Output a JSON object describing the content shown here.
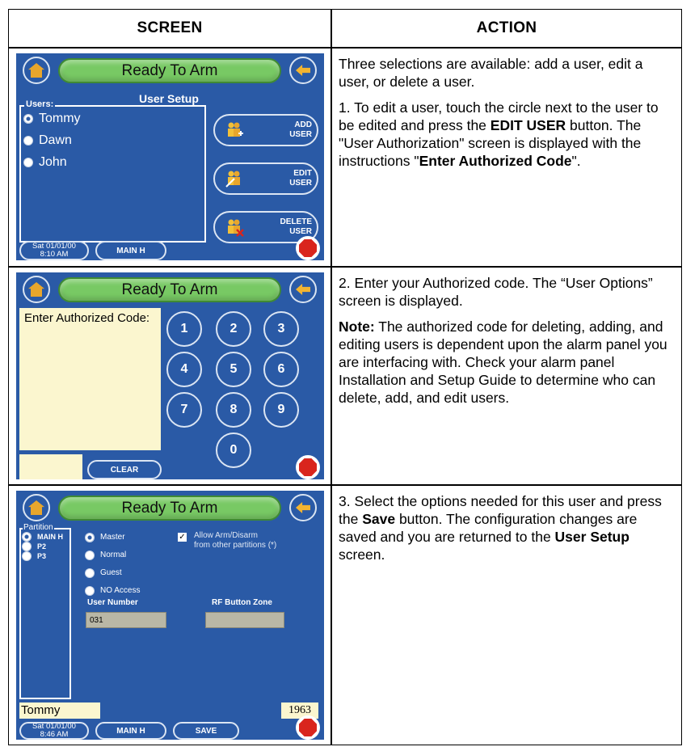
{
  "table": {
    "header_screen": "SCREEN",
    "header_action": "ACTION"
  },
  "row1": {
    "screen": {
      "title": "Ready To Arm",
      "section_title": "User Setup",
      "users_label": "Users:",
      "users": [
        "Tommy",
        "Dawn",
        "John"
      ],
      "selected_user": "Tommy",
      "buttons": {
        "add": [
          "ADD",
          "USER"
        ],
        "edit": [
          "EDIT",
          "USER"
        ],
        "delete": [
          "DELETE",
          "USER"
        ]
      },
      "date": "Sat 01/01/00",
      "time": "8:10 AM",
      "partition_button": "MAIN H"
    },
    "action": {
      "p1": "Three selections are available: add a user, edit a user, or delete a user.",
      "p2_a": "1. To edit a user, touch the circle next to the user to be edited and press the ",
      "p2_b": "EDIT USER",
      "p2_c": " button.  The \"User Authorization\" screen is displayed with the instructions \"",
      "p2_d": "Enter Authorized Code",
      "p2_e": "\"."
    }
  },
  "row2": {
    "screen": {
      "title": "Ready To Arm",
      "prompt": "Enter Authorized Code:",
      "keys": [
        "1",
        "2",
        "3",
        "4",
        "5",
        "6",
        "7",
        "8",
        "9",
        "0"
      ],
      "clear": "CLEAR"
    },
    "action": {
      "p1": "2. Enter your Authorized code.  The “User Options” screen is displayed.",
      "note_label": "Note:",
      "note_text": " The authorized code for deleting, adding, and editing users is dependent upon the alarm panel you are interfacing with. Check your alarm panel Installation and Setup Guide to determine who can delete, add, and edit users."
    }
  },
  "row3": {
    "screen": {
      "title": "Ready To Arm",
      "partition_label": "Partition",
      "partitions": [
        "MAIN H",
        "P2",
        "P3"
      ],
      "access_levels": [
        "Master",
        "Normal",
        "Guest",
        "NO Access"
      ],
      "allow_label_1": "Allow Arm/Disarm",
      "allow_label_2": "from other partitions (*)",
      "user_number_label": "User Number",
      "rf_zone_label": "RF Button Zone",
      "user_number": "031",
      "rf_zone": "",
      "name": "Tommy",
      "code": "1963",
      "date": "Sat 01/01/00",
      "time": "8:46 AM",
      "partition_button": "MAIN H",
      "save": "SAVE"
    },
    "action": {
      "p1_a": "3.  Select the options needed for this user and press the ",
      "p1_b": "Save",
      "p1_c": " button.  The configuration changes are saved and you are returned to the ",
      "p1_d": "User Setup",
      "p1_e": " screen."
    }
  },
  "colors": {
    "screen_blue": "#2a5aa6",
    "title_green": "#78c964",
    "panel_cream": "#fbf6cf",
    "field_grey": "#b9b7a6",
    "stop_red": "#d9251d"
  }
}
